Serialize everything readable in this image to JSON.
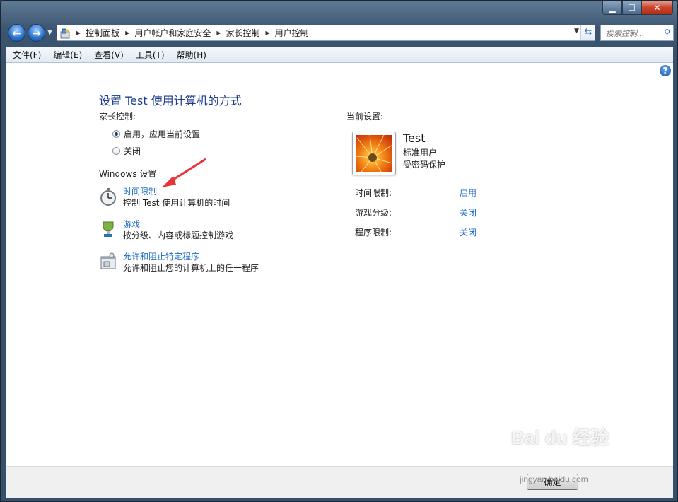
{
  "window": {
    "min_glyph": "▁",
    "max_glyph": "☐",
    "close_glyph": "✕"
  },
  "nav": {
    "back_glyph": "←",
    "forward_glyph": "→",
    "breadcrumbs": [
      "控制面板",
      "用户帐户和家庭安全",
      "家长控制",
      "用户控制"
    ],
    "search_placeholder": "搜索控制..."
  },
  "menu": [
    "文件(F)",
    "编辑(E)",
    "查看(V)",
    "工具(T)",
    "帮助(H)"
  ],
  "main": {
    "title": "设置 Test 使用计算机的方式",
    "parental_label": "家长控制:",
    "radio_on": "启用，应用当前设置",
    "radio_off": "关闭",
    "windows_settings": "Windows 设置",
    "tasks": [
      {
        "link": "时间限制",
        "desc": "控制 Test 使用计算机的时间"
      },
      {
        "link": "游戏",
        "desc": "按分级、内容或标题控制游戏"
      },
      {
        "link": "允许和阻止特定程序",
        "desc": "允许和阻止您的计算机上的任一程序"
      }
    ]
  },
  "current": {
    "label": "当前设置:",
    "user_name": "Test",
    "user_type": "标准用户",
    "password": "受密码保护",
    "settings": [
      {
        "name": "时间限制:",
        "value": "启用"
      },
      {
        "name": "游戏分级:",
        "value": "关闭"
      },
      {
        "name": "程序限制:",
        "value": "关闭"
      }
    ]
  },
  "footer": {
    "ok": "确定"
  },
  "watermark": {
    "logo": "Bai du 经验",
    "site": "jingyan.baidu.com"
  },
  "colors": {
    "link": "#1f6dc2",
    "title": "#1e3d8f",
    "arrow": "#e8333a"
  }
}
